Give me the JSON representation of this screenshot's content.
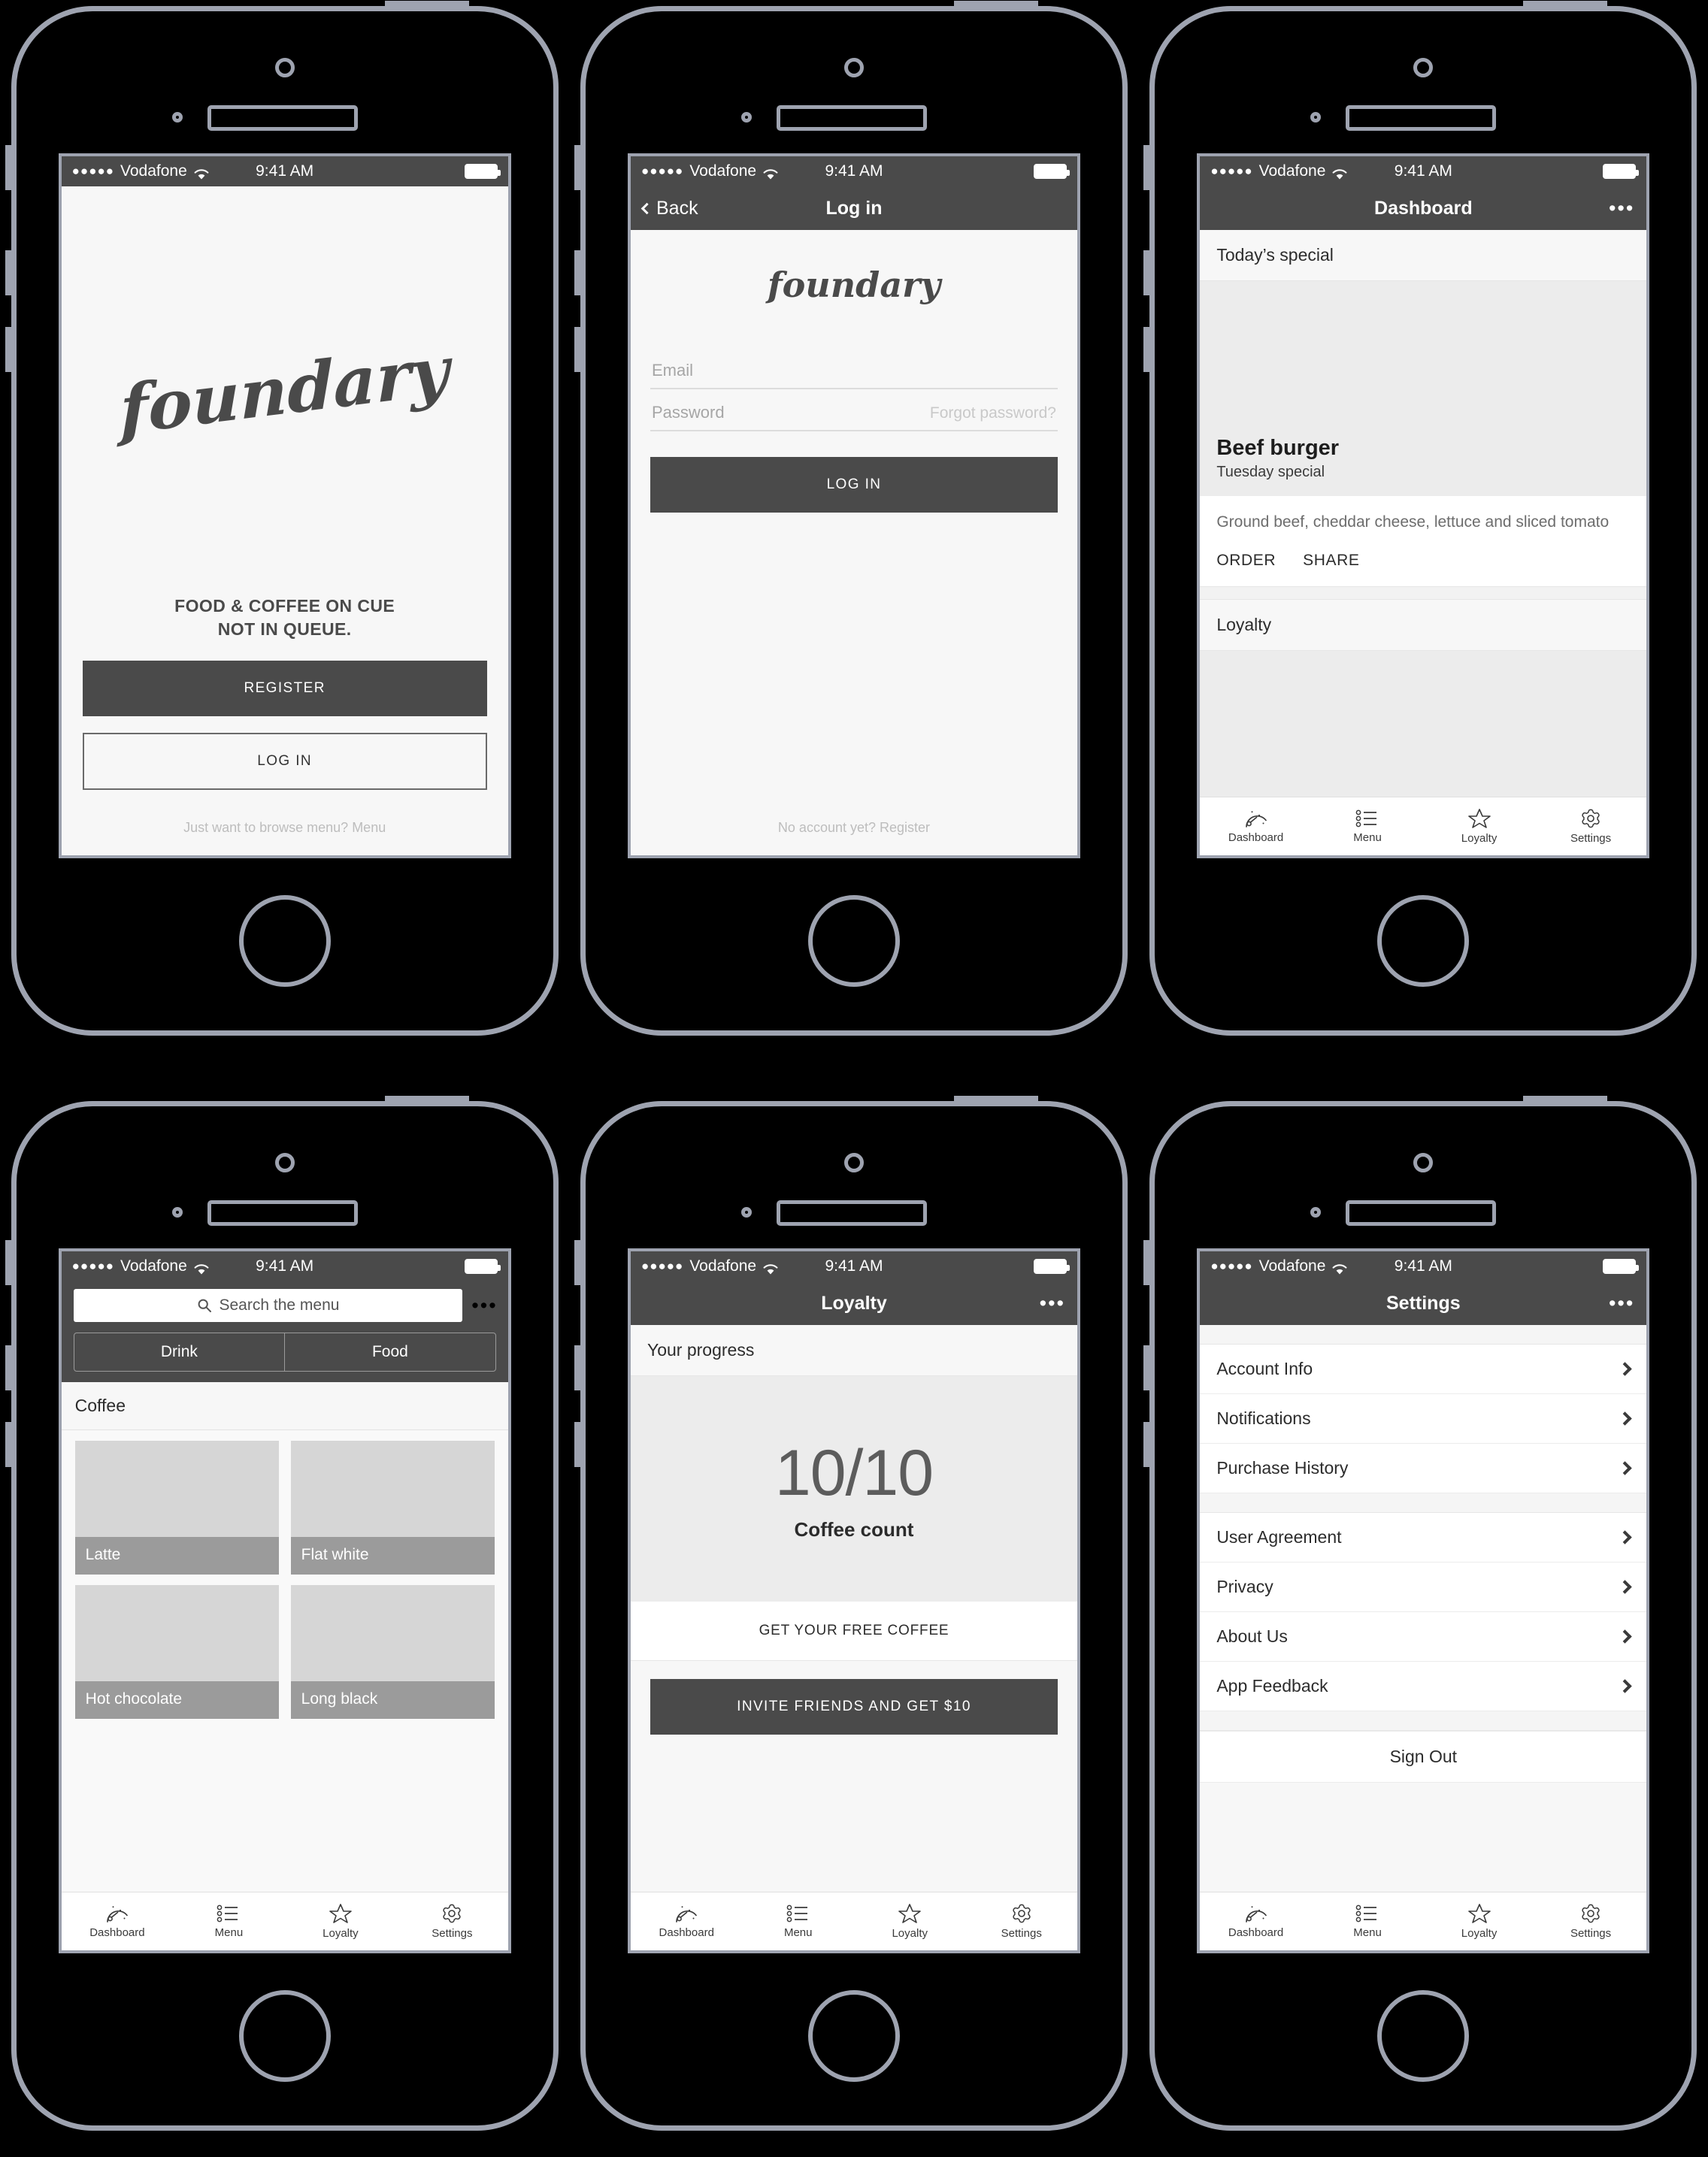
{
  "status_bar": {
    "signal_dots": "●●●●●",
    "carrier": "Vodafone",
    "time": "9:41 AM"
  },
  "brand": {
    "logo_text": "foundary"
  },
  "tab_bar": {
    "items": [
      {
        "label": "Dashboard",
        "icon": "speedometer-icon"
      },
      {
        "label": "Menu",
        "icon": "list-icon"
      },
      {
        "label": "Loyalty",
        "icon": "star-icon"
      },
      {
        "label": "Settings",
        "icon": "gear-icon"
      }
    ]
  },
  "screens": {
    "splash": {
      "tagline_line1": "FOOD & COFFEE ON CUE",
      "tagline_line2": "NOT IN QUEUE.",
      "register_label": "REGISTER",
      "login_label": "LOG IN",
      "browse_note": "Just want to browse menu? Menu"
    },
    "login": {
      "back_label": "Back",
      "title": "Log in",
      "email_placeholder": "Email",
      "password_placeholder": "Password",
      "forgot_label": "Forgot password?",
      "login_button": "LOG IN",
      "register_note": "No account yet? Register"
    },
    "dashboard": {
      "title": "Dashboard",
      "more_icon": "•••",
      "section_special": "Today’s special",
      "special_title": "Beef burger",
      "special_subtitle": "Tuesday special",
      "special_desc": "Ground beef, cheddar cheese, lettuce and sliced tomato",
      "action_order": "ORDER",
      "action_share": "SHARE",
      "section_loyalty": "Loyalty"
    },
    "menu": {
      "search_placeholder": "Search the menu",
      "more_icon": "•••",
      "segments": [
        "Drink",
        "Food"
      ],
      "category": "Coffee",
      "tiles": [
        "Latte",
        "Flat white",
        "Hot chocolate",
        "Long black"
      ]
    },
    "loyalty": {
      "title": "Loyalty",
      "more_icon": "•••",
      "section_progress": "Your progress",
      "count": "10/10",
      "count_label": "Coffee count",
      "free_coffee_link": "GET YOUR FREE COFFEE",
      "invite_button": "INVITE FRIENDS AND GET $10"
    },
    "settings": {
      "title": "Settings",
      "more_icon": "•••",
      "group1": [
        "Account Info",
        "Notifications",
        "Purchase History"
      ],
      "group2": [
        "User Agreement",
        "Privacy",
        "About Us",
        "App Feedback"
      ],
      "sign_out": "Sign Out"
    }
  },
  "colors": {
    "chrome": "#4a4a4a",
    "screen_bg": "#f7f7f7",
    "placeholder_grey": "#d6d6d6",
    "caption_grey": "#9b9b9b",
    "frame": "#9ea3b0"
  }
}
